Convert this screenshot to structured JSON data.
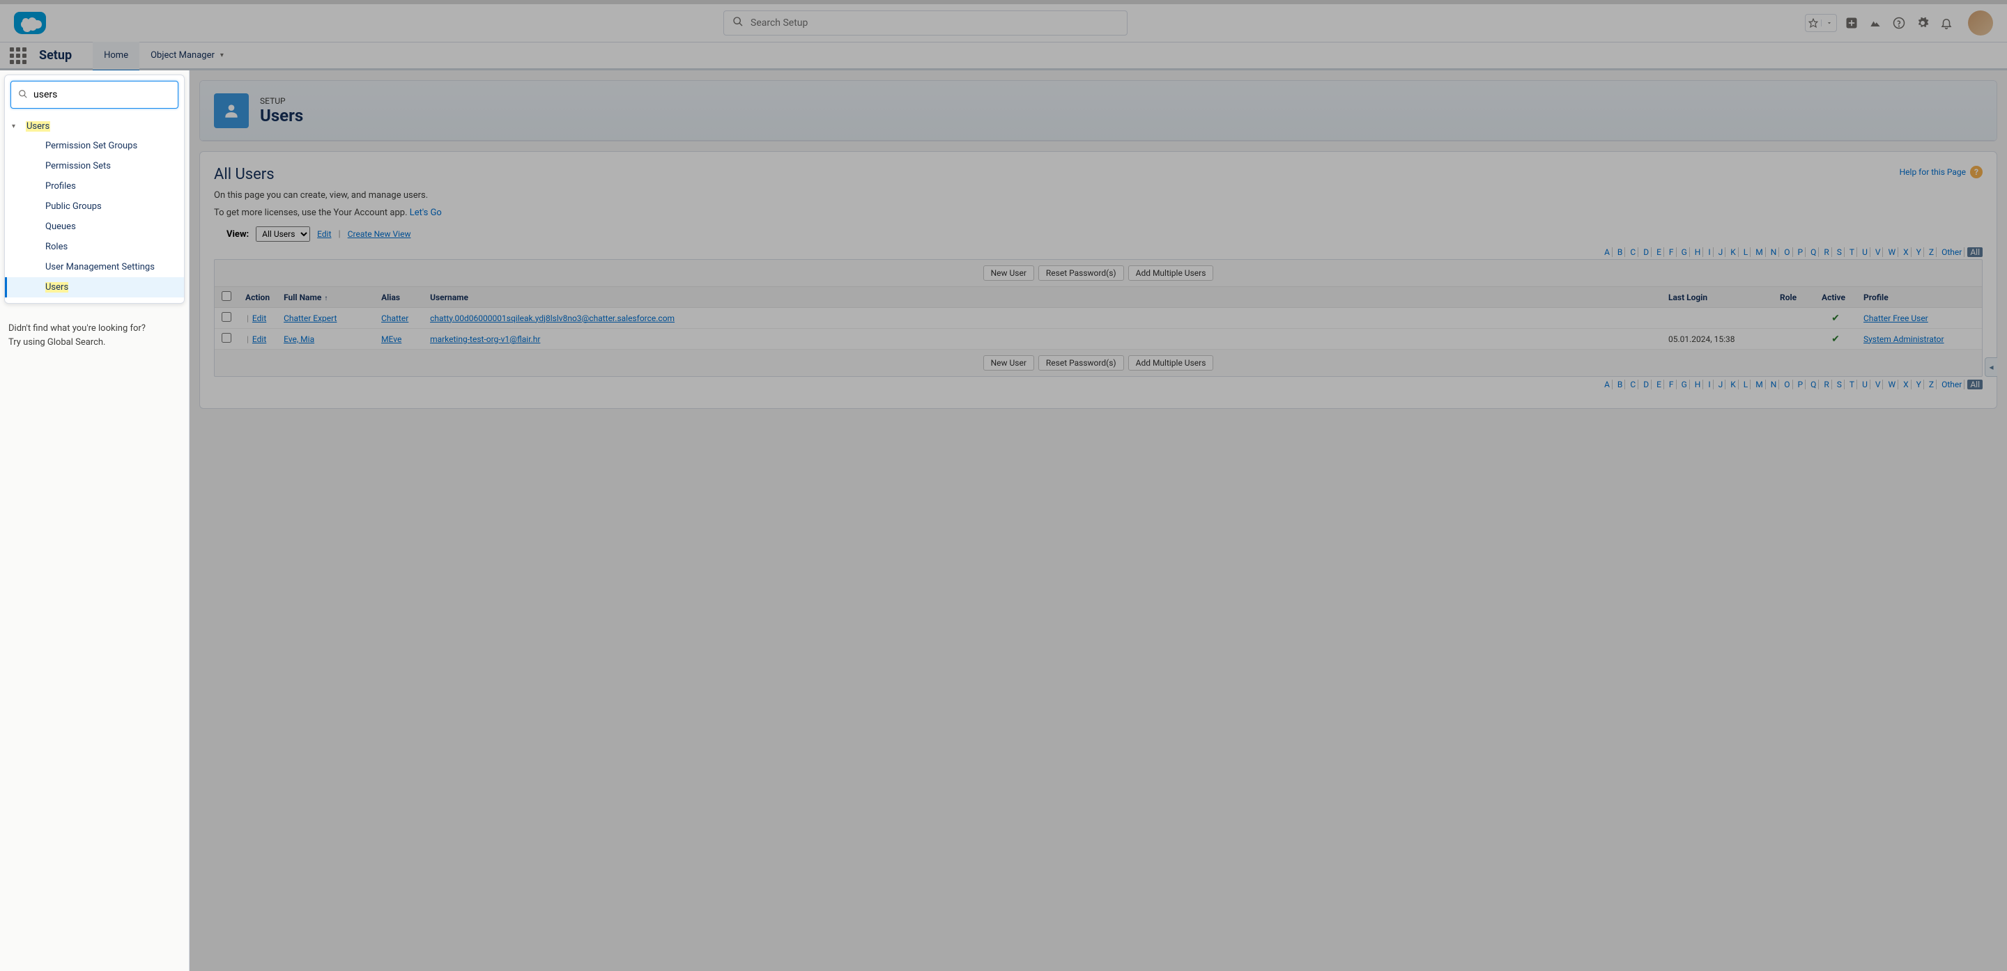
{
  "header": {
    "search_placeholder": "Search Setup"
  },
  "context": {
    "app_name": "Setup",
    "tabs": [
      "Home",
      "Object Manager"
    ]
  },
  "sidebar": {
    "quick_find_value": "users",
    "group": "Users",
    "items": [
      "Permission Set Groups",
      "Permission Sets",
      "Profiles",
      "Public Groups",
      "Queues",
      "Roles",
      "User Management Settings",
      "Users"
    ],
    "selected": "Users",
    "not_found_line1": "Didn't find what you're looking for?",
    "not_found_line2": "Try using Global Search."
  },
  "page": {
    "eyebrow": "SETUP",
    "title": "Users"
  },
  "content": {
    "title": "All Users",
    "help_text": "Help for this Page",
    "desc": "On this page you can create, view, and manage users.",
    "licenses_pre": "To get more licenses, use the Your Account app. ",
    "licenses_link": "Let's Go",
    "view_label": "View:",
    "view_value": "All Users",
    "view_edit": "Edit",
    "view_create": "Create New View",
    "alpha": [
      "A",
      "B",
      "C",
      "D",
      "E",
      "F",
      "G",
      "H",
      "I",
      "J",
      "K",
      "L",
      "M",
      "N",
      "O",
      "P",
      "Q",
      "R",
      "S",
      "T",
      "U",
      "V",
      "W",
      "X",
      "Y",
      "Z",
      "Other",
      "All"
    ],
    "buttons": {
      "new_user": "New User",
      "reset_pwd": "Reset Password(s)",
      "add_multi": "Add Multiple Users"
    },
    "columns": {
      "action": "Action",
      "full_name": "Full Name",
      "alias": "Alias",
      "username": "Username",
      "last_login": "Last Login",
      "role": "Role",
      "active": "Active",
      "profile": "Profile"
    },
    "action_edit": "Edit",
    "rows": [
      {
        "full_name": "Chatter Expert",
        "alias": "Chatter",
        "username": "chatty.00d06000001sqileak.ydj8lslv8no3@chatter.salesforce.com",
        "last_login": "",
        "role": "",
        "active": true,
        "profile": "Chatter Free User"
      },
      {
        "full_name": "Eve, Mia",
        "alias": "MEve",
        "username": "marketing-test-org-v1@flair.hr",
        "last_login": "05.01.2024, 15:38",
        "role": "",
        "active": true,
        "profile": "System Administrator"
      }
    ]
  }
}
